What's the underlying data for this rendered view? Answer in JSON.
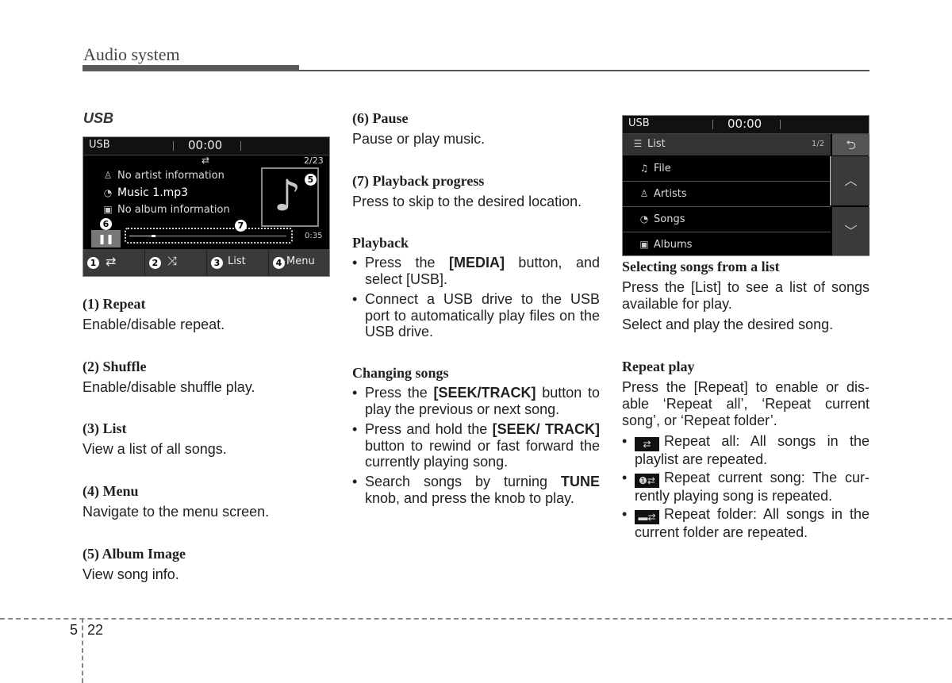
{
  "header": {
    "title": "Audio system"
  },
  "left": {
    "section_title": "USB",
    "screen": {
      "source": "USB",
      "clock": "00:00",
      "repeat_icon": "repeat-icon",
      "track_counter": "2/23",
      "artist": "No artist information",
      "title": "Music 1.mp3",
      "album": "No album information",
      "elapsed": "0:35",
      "progress_fraction": 0.14,
      "callouts": {
        "pause": "6",
        "progress": "7",
        "album": "5"
      },
      "buttons": [
        {
          "num": "1",
          "label": "",
          "icon": "repeat-icon"
        },
        {
          "num": "2",
          "label": "",
          "icon": "shuffle-icon"
        },
        {
          "num": "3",
          "label": "List",
          "icon": ""
        },
        {
          "num": "4",
          "label": "Menu",
          "icon": ""
        }
      ]
    },
    "items": [
      {
        "heading": "(1) Repeat",
        "text": "Enable/disable repeat."
      },
      {
        "heading": "(2) Shuffle",
        "text": "Enable/disable shuffle play."
      },
      {
        "heading": "(3) List",
        "text": "View a list of all songs."
      },
      {
        "heading": "(4) Menu",
        "text": "Navigate to the menu screen."
      },
      {
        "heading": "(5) Album Image",
        "text": "View song info."
      }
    ]
  },
  "middle": {
    "items": [
      {
        "heading": "(6) Pause",
        "text": "Pause or play music."
      },
      {
        "heading": "(7) Playback progress",
        "text": "Press to skip to the desired location."
      }
    ],
    "playback": {
      "heading": "Playback",
      "b1_pre": "Press the ",
      "b1_kw": "[MEDIA]",
      "b1_post": " button, and select [USB].",
      "b2": "Connect a USB drive to the USB port to automatically play files on the USB drive."
    },
    "changing": {
      "heading": "Changing songs",
      "b1_pre": "Press the ",
      "b1_kw": "[SEEK/TRACK]",
      "b1_post": " button to play the previous or next song.",
      "b2_pre": "Press and hold the ",
      "b2_kw": "[SEEK/ TRACK]",
      "b2_post": " button to rewind or fast forward the currently playing song.",
      "b3_pre": "Search songs by turning ",
      "b3_kw": "TUNE",
      "b3_post": " knob, and press the knob to play."
    }
  },
  "right": {
    "screen": {
      "source": "USB",
      "clock": "00:00",
      "list_title": "List",
      "page": "1/2",
      "rows": [
        {
          "label": "File",
          "icon": "music-note-icon"
        },
        {
          "label": "Artists",
          "icon": "person-icon"
        },
        {
          "label": "Songs",
          "icon": "disc-icon"
        },
        {
          "label": "Albums",
          "icon": "album-icon"
        }
      ]
    },
    "selecting": {
      "heading": "Selecting songs from a list",
      "p1": "Press the [List] to see a list of songs available for play.",
      "p2": "Select and play the desired song."
    },
    "repeat": {
      "heading": "Repeat play",
      "p1": "Press the [Repeat] to enable or dis-able ‘Repeat all’, ‘Repeat current song’, or ‘Repeat folder’.",
      "b1": "Repeat all: All songs in the playlist are repeated.",
      "b2": "Repeat current song: The cur-rently playing song is repeated.",
      "b3": "Repeat folder: All songs in the current folder are repeated."
    }
  },
  "footer": {
    "chapter": "5",
    "page": "22"
  }
}
